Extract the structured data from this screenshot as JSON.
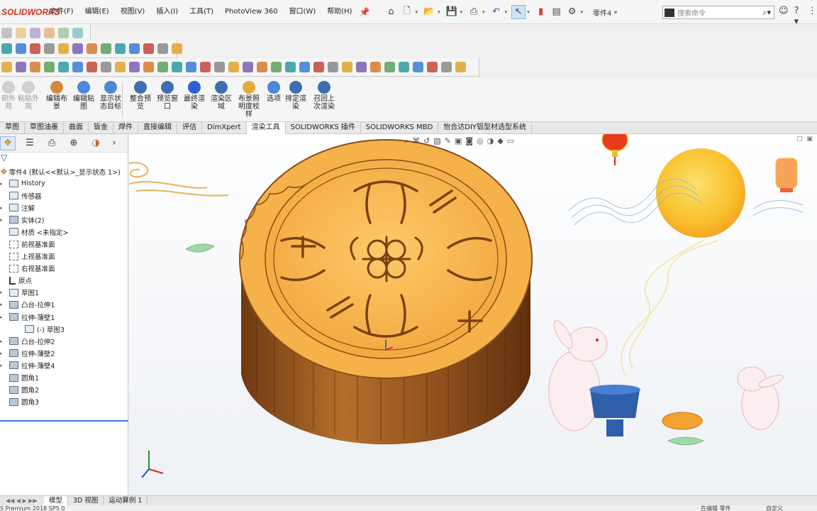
{
  "app": {
    "logo_text": "SOLIDWORKS",
    "document_title": "零件4 *",
    "brand_color": "#d52b1e",
    "accent_color": "#3a7fd5"
  },
  "menu": [
    "文件(F)",
    "编辑(E)",
    "视图(V)",
    "插入(I)",
    "工具(T)",
    "PhotoView 360",
    "窗口(W)",
    "帮助(H)"
  ],
  "quick_access_icons": [
    "home-icon",
    "new-document-icon",
    "open-icon",
    "save-icon",
    "print-icon",
    "undo-icon",
    "select-pointer-icon",
    "rebuild-icon",
    "file-properties-icon",
    "options-gear-icon"
  ],
  "search": {
    "placeholder": "搜索命令"
  },
  "top_right_icons": [
    "user-icon",
    "help-icon"
  ],
  "command_manager": {
    "buttons": [
      {
        "label": "刚外\n观",
        "icon": "appearance-icon",
        "enabled": false
      },
      {
        "label": "粘贴外\n观",
        "icon": "paste-appearance-icon",
        "enabled": false
      },
      {
        "label": "编辑布\n景",
        "icon": "edit-scene-icon",
        "enabled": true
      },
      {
        "label": "编辑贴\n图",
        "icon": "edit-decal-icon",
        "enabled": true
      },
      {
        "label": "显示状\n态目标",
        "icon": "display-state-target-icon",
        "enabled": true
      },
      {
        "label": "整合预\n览",
        "icon": "integrated-preview-icon",
        "enabled": true
      },
      {
        "label": "预览窗\n口",
        "icon": "preview-window-icon",
        "enabled": true
      },
      {
        "label": "最终渲\n染",
        "icon": "final-render-icon",
        "enabled": true
      },
      {
        "label": "渲染区\n域",
        "icon": "render-region-icon",
        "enabled": true
      },
      {
        "label": "布景照\n明度校\n样",
        "icon": "scene-illumination-icon",
        "enabled": true
      },
      {
        "label": "选项",
        "icon": "options-icon",
        "enabled": true
      },
      {
        "label": "排定渲\n染",
        "icon": "schedule-render-icon",
        "enabled": true
      },
      {
        "label": "召回上\n次渲染",
        "icon": "recall-render-icon",
        "enabled": true
      }
    ]
  },
  "tabs": [
    {
      "label": "草图",
      "active": false
    },
    {
      "label": "草图油墨",
      "active": false
    },
    {
      "label": "曲面",
      "active": false
    },
    {
      "label": "钣金",
      "active": false
    },
    {
      "label": "焊件",
      "active": false
    },
    {
      "label": "直接编辑",
      "active": false
    },
    {
      "label": "评估",
      "active": false
    },
    {
      "label": "DimXpert",
      "active": false
    },
    {
      "label": "渲染工具",
      "active": true
    },
    {
      "label": "SOLIDWORKS 插件",
      "active": false
    },
    {
      "label": "SOLIDWORKS MBD",
      "active": false
    },
    {
      "label": "怡合达DIY铝型材选型系统",
      "active": false
    }
  ],
  "feature_tree": {
    "panel_tabs": [
      "feature-manager-icon",
      "property-manager-icon",
      "configuration-manager-icon",
      "dimxpert-manager-icon",
      "display-manager-icon"
    ],
    "root_label": "零件4 (默认<<默认>_显示状态 1>)",
    "items": [
      {
        "label": "History",
        "icon": "history",
        "expandable": true
      },
      {
        "label": "传感器",
        "icon": "sensor",
        "expandable": false
      },
      {
        "label": "注解",
        "icon": "annotation",
        "expandable": true
      },
      {
        "label": "实体(2)",
        "icon": "solid",
        "expandable": true
      },
      {
        "label": "材质 <未指定>",
        "icon": "material",
        "expandable": false
      },
      {
        "label": "前视基准面",
        "icon": "plane",
        "expandable": false
      },
      {
        "label": "上视基准面",
        "icon": "plane",
        "expandable": false
      },
      {
        "label": "右视基准面",
        "icon": "plane",
        "expandable": false
      },
      {
        "label": "原点",
        "icon": "origin",
        "expandable": false
      },
      {
        "label": "草图1",
        "icon": "sketch",
        "expandable": true
      },
      {
        "label": "凸台-拉伸1",
        "icon": "solid",
        "expandable": true
      },
      {
        "label": "拉伸-薄壁1",
        "icon": "solid",
        "expandable": true
      },
      {
        "label": "(-) 草图3",
        "icon": "sketch",
        "expandable": false,
        "indent": true
      },
      {
        "label": "凸台-拉伸2",
        "icon": "solid",
        "expandable": true
      },
      {
        "label": "拉伸-薄壁2",
        "icon": "solid",
        "expandable": true
      },
      {
        "label": "拉伸-薄壁4",
        "icon": "solid",
        "expandable": true
      },
      {
        "label": "圆角1",
        "icon": "fillet",
        "expandable": false
      },
      {
        "label": "圆角2",
        "icon": "fillet",
        "expandable": false
      },
      {
        "label": "圆角3",
        "icon": "fillet",
        "expandable": false
      }
    ]
  },
  "viewport": {
    "heads_up_icons": [
      "zoom-to-fit-icon",
      "zoom-area-icon",
      "previous-view-icon",
      "section-view-icon",
      "dynamic-annotation-icon",
      "view-orientation-icon",
      "display-style-icon",
      "hide-show-items-icon",
      "edit-appearance-icon",
      "apply-scene-icon",
      "view-settings-icon"
    ],
    "model": "mooncake",
    "colors": {
      "cake_top": "#f5b14a",
      "cake_side": "#9a5a21",
      "moon": "#f9c12e"
    }
  },
  "bottom_tabs": [
    {
      "label": "模型",
      "active": true
    },
    {
      "label": "3D 视图",
      "active": false
    },
    {
      "label": "运动算例 1",
      "active": false
    }
  ],
  "status": {
    "left": "S Premium 2018 SP5.0",
    "middle": "在编辑 零件",
    "right": "自定义"
  }
}
